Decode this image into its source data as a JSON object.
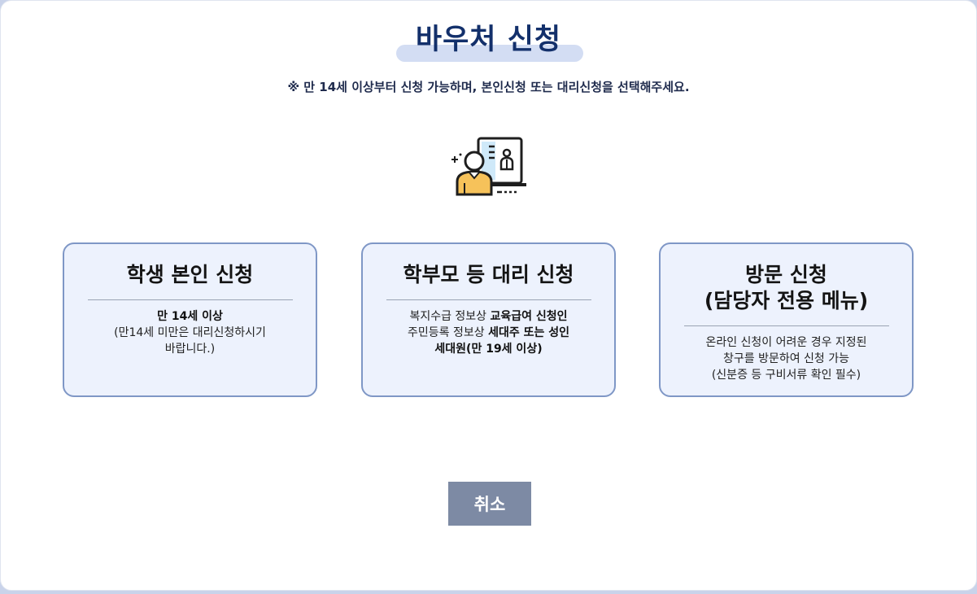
{
  "header": {
    "title": "바우처 신청",
    "notice": "※ 만 14세 이상부터 신청 가능하며, 본인신청 또는 대리신청을 선택해주세요."
  },
  "cards": [
    {
      "title_line1": "학생 본인 신청",
      "desc": [
        {
          "parts": [
            {
              "text": "만 14세 이상",
              "bold": true
            }
          ]
        },
        {
          "parts": [
            {
              "text": "(만14세 미만은 대리신청하시기",
              "bold": false
            }
          ]
        },
        {
          "parts": [
            {
              "text": "바랍니다.)",
              "bold": false
            }
          ]
        }
      ]
    },
    {
      "title_line1": "학부모 등 대리 신청",
      "desc": [
        {
          "parts": [
            {
              "text": "복지수급 정보상 ",
              "bold": false
            },
            {
              "text": "교육급여 신청인",
              "bold": true
            }
          ]
        },
        {
          "parts": [
            {
              "text": "주민등록 정보상 ",
              "bold": false
            },
            {
              "text": "세대주 또는 성인",
              "bold": true
            }
          ]
        },
        {
          "parts": [
            {
              "text": "세대원(만 19세 이상)",
              "bold": true
            }
          ]
        }
      ]
    },
    {
      "title_line1": "방문 신청",
      "title_line2": "(담당자 전용 메뉴)",
      "desc": [
        {
          "parts": [
            {
              "text": "온라인 신청이 어려운 경우 지정된",
              "bold": false
            }
          ]
        },
        {
          "parts": [
            {
              "text": "창구를 방문하여 신청 가능",
              "bold": false
            }
          ]
        },
        {
          "parts": [
            {
              "text": "(신분증 등 구비서류 확인 필수)",
              "bold": false
            }
          ]
        }
      ]
    }
  ],
  "cancel_label": "취소",
  "colors": {
    "title": "#13306b",
    "card_bg": "#edf2fd",
    "card_border": "#7f97c6",
    "cancel_bg": "#7d8aa4"
  },
  "icons": {
    "illustration": "person-monitor-illustration-icon"
  }
}
